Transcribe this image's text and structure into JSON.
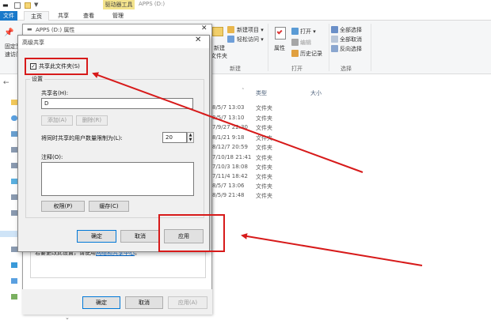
{
  "explorer": {
    "quick_access_num": "▼",
    "context_tab": "驱动器工具",
    "window_title": "APPS (D:)",
    "tabs": {
      "file": "文件",
      "home": "主页",
      "share": "共享",
      "view": "查看",
      "manage": "管理"
    },
    "ribbon": {
      "pin_line1": "固定到",
      "pin_line2": "速访问",
      "new_item": "新建项目 ▾",
      "easy_access": "轻松访问 ▾",
      "new_folder_1": "新建",
      "new_folder_2": "文件夹",
      "group_new": "新建",
      "properties": "属性",
      "open": "打开 ▾",
      "edit": "编辑",
      "history": "历史记录",
      "group_open": "打开",
      "select_all": "全部选择",
      "select_none": "全部取消",
      "invert": "反向选择",
      "group_select": "选择"
    },
    "columns": {
      "type": "类型",
      "size": "大小"
    },
    "rows": [
      {
        "date": "8/5/7 13:03",
        "type": "文件夹"
      },
      {
        "date": "8/5/7 13:10",
        "type": "文件夹"
      },
      {
        "date": "7/9/27 22:30",
        "type": "文件夹"
      },
      {
        "date": "8/1/21 9:18",
        "type": "文件夹"
      },
      {
        "date": "8/12/7 20:59",
        "type": "文件夹"
      },
      {
        "date": "7/10/18 21:41",
        "type": "文件夹"
      },
      {
        "date": "7/10/3 18:08",
        "type": "文件夹"
      },
      {
        "date": "7/11/4 18:42",
        "type": "文件夹"
      },
      {
        "date": "8/5/7 13:06",
        "type": "文件夹"
      },
      {
        "date": "8/5/9 21:48",
        "type": "文件夹"
      }
    ]
  },
  "properties_dialog": {
    "title": "APPS (D:) 属性",
    "close": "✕",
    "hint_prefix": "若要更改此设置，请使用",
    "hint_link": "网络和共享中心",
    "hint_suffix": "。",
    "ok": "确定",
    "cancel": "取消",
    "apply": "应用(A)"
  },
  "advanced_sharing": {
    "title": "高级共享",
    "close": "✕",
    "share_checkbox_label": "共享此文件夹(S)",
    "share_checked": "✓",
    "settings_legend": "设置",
    "share_name_label": "共享名(H):",
    "share_name_value": "D",
    "add_button": "添加(A)",
    "remove_button": "删除(R)",
    "user_limit_label": "将同时共享的用户数量限制为(L):",
    "user_limit_value": "20",
    "comments_label": "注释(O):",
    "comments_value": "",
    "permissions_button": "权限(P)",
    "caching_button": "缓存(C)",
    "ok": "确定",
    "cancel": "取消",
    "apply": "应用"
  },
  "colors": {
    "annotation_red": "#d71a1a",
    "accent_blue": "#1979ca"
  }
}
